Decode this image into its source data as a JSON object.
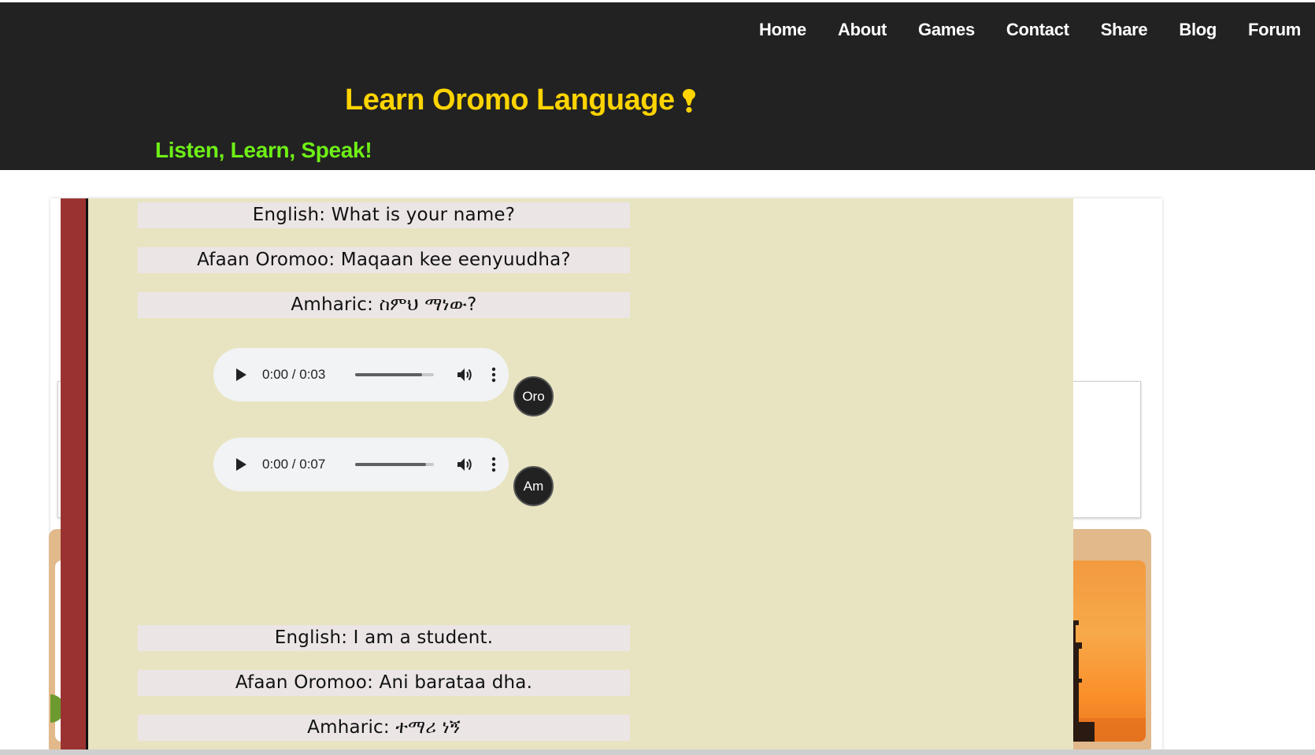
{
  "nav": {
    "items": [
      {
        "label": "Home"
      },
      {
        "label": "About"
      },
      {
        "label": "Games"
      },
      {
        "label": "Contact"
      },
      {
        "label": "Share"
      },
      {
        "label": "Blog"
      },
      {
        "label": "Forum"
      }
    ]
  },
  "header": {
    "title": "Learn Oromo Language",
    "title_icon": "exclamation-icon",
    "tagline": "Listen, Learn, Speak!",
    "title_color": "#ffd400",
    "tagline_color": "#6ef016",
    "background": "#222222"
  },
  "lesson": {
    "background": "#e8e4c2",
    "bar_color": "#9a3232",
    "phrases": [
      {
        "english": "English: What is your name?",
        "oromo": "Afaan Oromoo: Maqaan kee eenyuudha?",
        "amharic": "Amharic: ስምህ ማነው?",
        "audio": [
          {
            "time": "0:00 / 0:03",
            "button": "Oro",
            "volume_level": 0.85
          },
          {
            "time": "0:00 / 0:07",
            "button": "Am",
            "volume_level": 0.9
          }
        ]
      },
      {
        "english": "English: I am a student.",
        "oromo": "Afaan Oromoo: Ani barataa dha.",
        "amharic": "Amharic: ተማሪ ነኝ"
      }
    ]
  }
}
